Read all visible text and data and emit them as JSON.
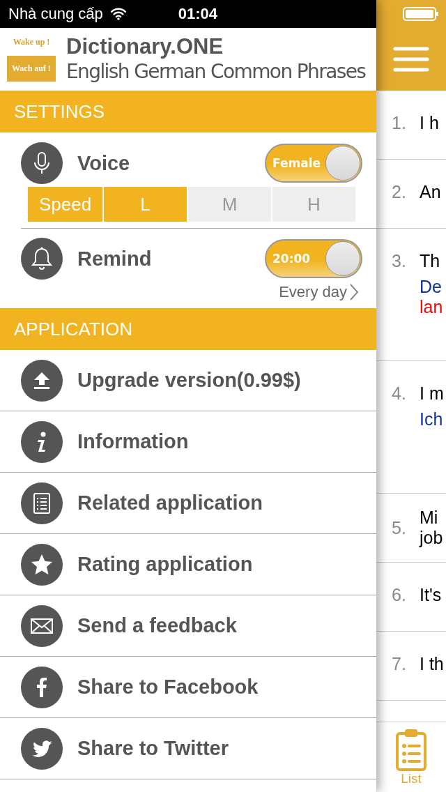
{
  "status_bar": {
    "carrier": "Nhà cung cấp",
    "time": "01:04"
  },
  "header": {
    "logo_top": "Wake up !",
    "logo_bottom": "Wach auf !",
    "title": "Dictionary.ONE",
    "subtitle": "English German Common Phrases"
  },
  "settings": {
    "heading": "SETTINGS",
    "voice": {
      "label": "Voice",
      "toggle_text": "Female",
      "on": true
    },
    "speed": {
      "label": "Speed",
      "options": [
        {
          "label": "L",
          "selected": true
        },
        {
          "label": "M",
          "selected": false
        },
        {
          "label": "H",
          "selected": false
        }
      ]
    },
    "remind": {
      "label": "Remind",
      "toggle_text": "20:00",
      "on": true,
      "repeat": "Every day"
    }
  },
  "application": {
    "heading": "APPLICATION",
    "items": [
      {
        "kind": "upload",
        "label": "Upgrade version(0.99$)"
      },
      {
        "kind": "info",
        "label": "Information"
      },
      {
        "kind": "list",
        "label": "Related application"
      },
      {
        "kind": "star",
        "label": "Rating application"
      },
      {
        "kind": "mail",
        "label": "Send a feedback"
      },
      {
        "kind": "facebook",
        "label": "Share to Facebook"
      },
      {
        "kind": "twitter",
        "label": "Share to Twitter"
      }
    ]
  },
  "list": {
    "rows": [
      {
        "number": "1.",
        "lines": [
          {
            "kind": "phrase",
            "text": "I h"
          }
        ]
      },
      {
        "number": "2.",
        "lines": [
          {
            "kind": "phrase",
            "text": "An"
          }
        ]
      },
      {
        "number": "3.",
        "lines": [
          {
            "kind": "phrase",
            "text": "Th"
          },
          {
            "kind": "translation",
            "text": "De"
          },
          {
            "kind": "note",
            "text": "lan"
          }
        ]
      },
      {
        "number": "4.",
        "lines": [
          {
            "kind": "phrase",
            "text": "I m"
          },
          {
            "kind": "translation",
            "text": "Ich"
          }
        ]
      },
      {
        "number": "5.",
        "lines": [
          {
            "kind": "phrase",
            "text": "Mi"
          },
          {
            "kind": "phrase",
            "text": "job"
          }
        ]
      },
      {
        "number": "6.",
        "lines": [
          {
            "kind": "phrase",
            "text": "It's"
          }
        ]
      },
      {
        "number": "7.",
        "lines": [
          {
            "kind": "phrase",
            "text": "I th"
          }
        ]
      }
    ]
  },
  "tab_bar": {
    "tabs": [
      {
        "label": "List",
        "selected": true
      }
    ]
  }
}
